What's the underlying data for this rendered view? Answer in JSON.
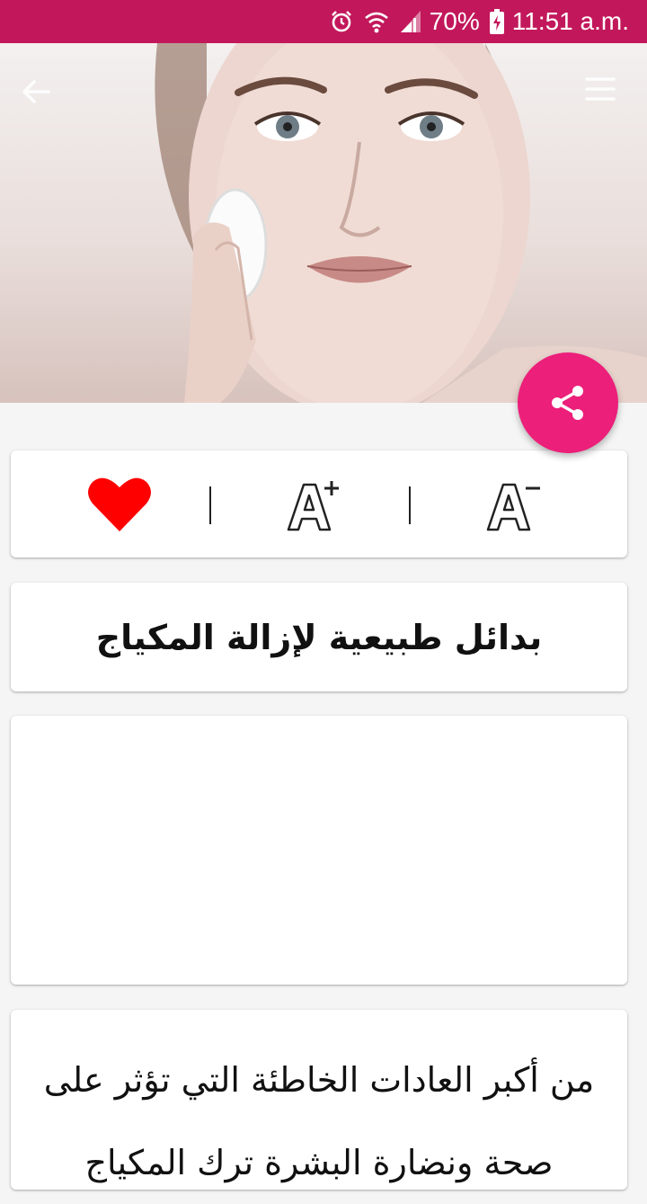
{
  "status_bar": {
    "battery_percent": "70%",
    "time": "11:51 a.m.",
    "icons": [
      "alarm-icon",
      "wifi-icon",
      "signal-icon",
      "battery-charging-icon"
    ]
  },
  "header": {
    "back_icon": "arrow-back-icon",
    "menu_icon": "menu-icon"
  },
  "fab": {
    "icon": "share-icon",
    "color": "#ec1f7a"
  },
  "toolbar": {
    "items": [
      {
        "name": "favorite",
        "icon": "heart-icon",
        "color": "#ff0000"
      },
      {
        "name": "font-increase",
        "icon": "font-increase-icon"
      },
      {
        "name": "font-decrease",
        "icon": "font-decrease-icon"
      }
    ]
  },
  "article": {
    "title": "بدائل طبيعية لإزالة المكياج",
    "body": "من أكبر العادات الخاطئة التي تؤثر على صحة ونضارة البشرة ترك المكياج"
  },
  "colors": {
    "status_bar": "#c2185b",
    "accent": "#ec1f7a",
    "background": "#f5f5f5"
  }
}
